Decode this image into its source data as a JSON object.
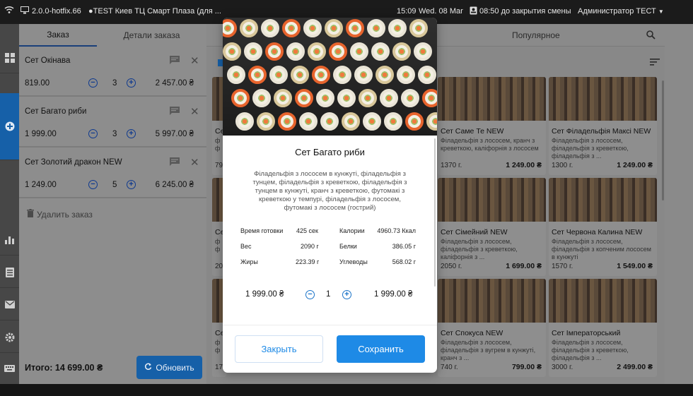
{
  "topbar": {
    "version": "2.0.0-hotfix.66",
    "store": "TEST Киев ТЦ Смарт Плаза (для ...",
    "time": "15:09",
    "date": "Wed. 08 Mar",
    "shift": "08:50 до закрытия смены",
    "user": "Администратор ТЕСТ"
  },
  "order_panel": {
    "tabs": [
      "Заказ",
      "Детали заказа"
    ],
    "items": [
      {
        "name": "Сет Окінава",
        "price": "819.00",
        "qty": "3",
        "total": "2 457.00 ₴"
      },
      {
        "name": "Сет Багато риби",
        "price": "1 999.00",
        "qty": "3",
        "total": "5 997.00 ₴"
      },
      {
        "name": "Сет Золотий дракон NEW",
        "price": "1 249.00",
        "qty": "5",
        "total": "6 245.00 ₴"
      }
    ],
    "delete_label": "Удалить заказ",
    "total_label": "Итого: 14 699.00 ₴",
    "refresh_label": "Обновить"
  },
  "menu": {
    "popular_tab": "Популярное",
    "partial": [
      {
        "name": "Се",
        "desc": "ф\nф",
        "weight": "79"
      },
      {
        "name": "Се",
        "desc": "ф\nф",
        "weight": "20"
      },
      {
        "name": "Се",
        "desc": "ф\nф",
        "weight": "17"
      }
    ],
    "products": [
      {
        "name": "Сет Саме Те NEW",
        "desc": "Філадельфія з лососем, кранч з креветкою, каліфорнія з лососем",
        "weight": "1370 г.",
        "price": "1 249.00 ₴"
      },
      {
        "name": "Сет Філадельфія Максі NEW",
        "desc": "Філадельфія з лососем, філадельфія з креветкою, філадельфія з ...",
        "weight": "1300 г.",
        "price": "1 249.00 ₴"
      },
      {
        "name": "Сет Сімейний NEW",
        "desc": "Філадельфія з лососем, філадельфія з креветкою, каліфорнія з ...",
        "weight": "2050 г.",
        "price": "1 699.00 ₴"
      },
      {
        "name": "Сет Червона Калина NEW",
        "desc": "Філадельфія з лососем, філадельфія з копченим лососем в кунжуті",
        "weight": "1570 г.",
        "price": "1 549.00 ₴"
      },
      {
        "name": "Сет Спокуса NEW",
        "desc": "Філадельфія з лососем, філадельфія з вугрем в кунжуті, кранч з ...",
        "weight": "740 г.",
        "price": "799.00 ₴"
      },
      {
        "name": "Сет Імператорський",
        "desc": "Філадельфія з лососем, філадельфія з креветкою, філадельфія з ...",
        "weight": "3000 г.",
        "price": "2 499.00 ₴"
      }
    ]
  },
  "modal": {
    "title": "Сет Багато риби",
    "description": "Філадельфія з лососем в кунжуті, філадельфія з тунцем, філадельфія з креветкою, філадельфія з тунцем в кунжуті, кранч з креветкою, футомакі з креветкою у темпурі, філадельфія з лососем, футомакі з лососем (гострий)",
    "stats": {
      "time_label": "Время готовки",
      "time_value": "425 сек",
      "cal_label": "Калории",
      "cal_value": "4960.73 Ккал",
      "weight_label": "Вес",
      "weight_value": "2090 г",
      "protein_label": "Белки",
      "protein_value": "386.05 г",
      "fat_label": "Жиры",
      "fat_value": "223.39 г",
      "carb_label": "Углеводы",
      "carb_value": "568.02 г"
    },
    "unit_price": "1 999.00 ₴",
    "qty": "1",
    "line_total": "1 999.00 ₴",
    "close_label": "Закрыть",
    "save_label": "Сохранить"
  },
  "colors": {
    "accent": "#1e8ae6",
    "dark_accent": "#1660a8",
    "stepper": "#1a73c8"
  }
}
